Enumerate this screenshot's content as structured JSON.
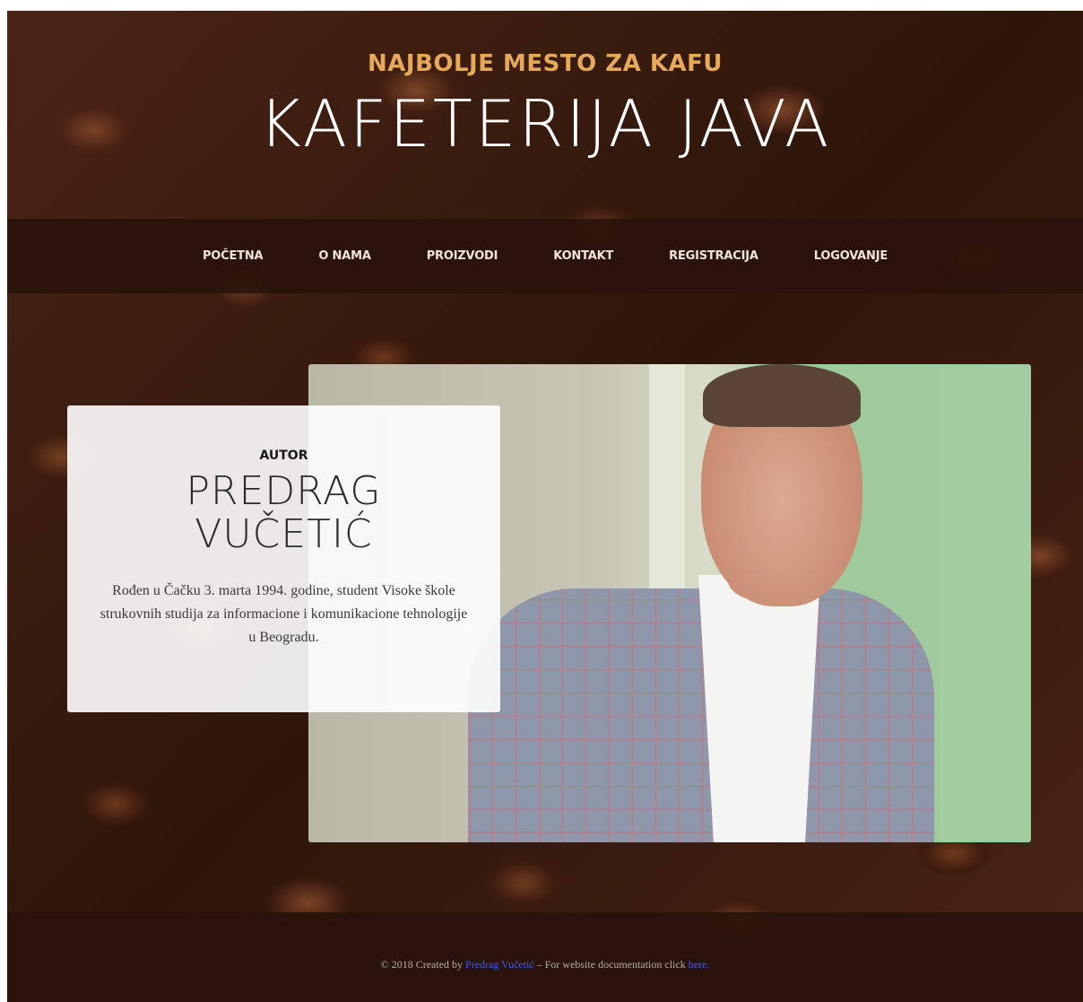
{
  "hero": {
    "tagline": "NAJBOLJE MESTO ZA KAFU",
    "title": "KAFETERIJA JAVA"
  },
  "nav": {
    "items": [
      {
        "label": "POČETNA"
      },
      {
        "label": "O NAMA"
      },
      {
        "label": "PROIZVODI"
      },
      {
        "label": "KONTAKT"
      },
      {
        "label": "REGISTRACIJA"
      },
      {
        "label": "LOGOVANJE"
      }
    ]
  },
  "about": {
    "label": "AUTOR",
    "name_line1": "PREDRAG",
    "name_line2": "VUČETIĆ",
    "bio": "Rođen u Čačku 3. marta 1994. godine, student Visoke škole strukovnih studija za informacione i komunikacione tehnologije u Beogradu."
  },
  "footer": {
    "prefix": "© 2018 Created by ",
    "author_link": "Predrag Vučetić",
    "middle": " – For website documentation click ",
    "doc_link": "here."
  },
  "colors": {
    "accent": "#e6a95a",
    "link": "#3b5bff",
    "nav_bg": "#28120a"
  }
}
